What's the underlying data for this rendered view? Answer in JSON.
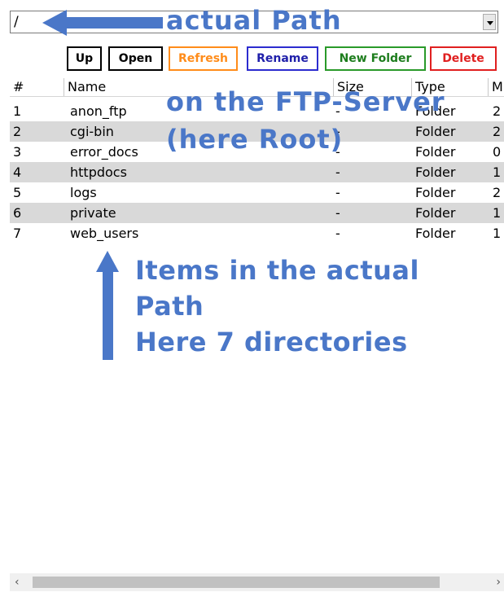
{
  "path_bar": {
    "value": "/"
  },
  "toolbar": {
    "up": "Up",
    "open": "Open",
    "refresh": "Refresh",
    "rename": "Rename",
    "new_folder": "New Folder",
    "delete": "Delete"
  },
  "columns": {
    "num": "#",
    "name": "Name",
    "size": "Size",
    "type": "Type",
    "modified": "M"
  },
  "rows": [
    {
      "num": "1",
      "name": "anon_ftp",
      "size": "-",
      "type": "Folder",
      "mod": "2"
    },
    {
      "num": "2",
      "name": "cgi-bin",
      "size": "-",
      "type": "Folder",
      "mod": "2"
    },
    {
      "num": "3",
      "name": "error_docs",
      "size": "-",
      "type": "Folder",
      "mod": "0"
    },
    {
      "num": "4",
      "name": "httpdocs",
      "size": "-",
      "type": "Folder",
      "mod": "1"
    },
    {
      "num": "5",
      "name": "logs",
      "size": "-",
      "type": "Folder",
      "mod": "2"
    },
    {
      "num": "6",
      "name": "private",
      "size": "-",
      "type": "Folder",
      "mod": "1"
    },
    {
      "num": "7",
      "name": "web_users",
      "size": "-",
      "type": "Folder",
      "mod": "1"
    }
  ],
  "annotations": {
    "path": "actual Path",
    "ftp_line1": "on the FTP-Server",
    "ftp_line2": "(here Root)",
    "items_line1": "Items in the actual",
    "items_line2": "Path",
    "items_line3": "Here 7 directories"
  },
  "scrollbar": {
    "left_icon": "chevron-left-icon",
    "right_icon": "chevron-right-icon"
  },
  "colors": {
    "annotation": "#4a77c8",
    "refresh": "#ff8c1a",
    "rename": "#2020aa",
    "new_folder": "#1d7d1d",
    "delete": "#e02020",
    "alt_row": "#d9d9d9"
  }
}
